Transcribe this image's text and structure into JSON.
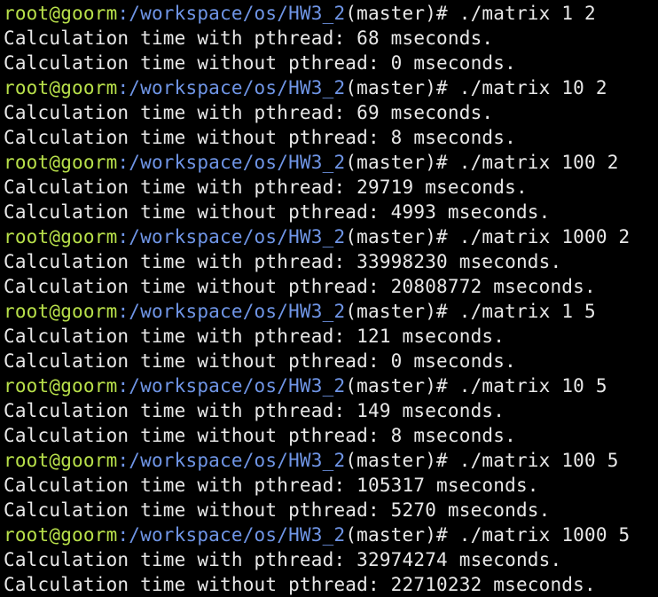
{
  "colors": {
    "background": "#000000",
    "prompt_user": "#b8e04a",
    "prompt_path": "#6f95e6",
    "text": "#e8e8e8"
  },
  "prompt": {
    "user_host": "root@goorm",
    "path": ":/workspace/os/HW3_2",
    "branch_suffix": "(master)# "
  },
  "runs": [
    {
      "command": "./matrix 1 2",
      "with_pthread": "Calculation time with pthread: 68 mseconds.",
      "without_pthread": "Calculation time without pthread: 0 mseconds."
    },
    {
      "command": "./matrix 10 2",
      "with_pthread": "Calculation time with pthread: 69 mseconds.",
      "without_pthread": "Calculation time without pthread: 8 mseconds."
    },
    {
      "command": "./matrix 100 2",
      "with_pthread": "Calculation time with pthread: 29719 mseconds.",
      "without_pthread": "Calculation time without pthread: 4993 mseconds."
    },
    {
      "command": "./matrix 1000 2",
      "with_pthread": "Calculation time with pthread: 33998230 mseconds.",
      "without_pthread": "Calculation time without pthread: 20808772 mseconds."
    },
    {
      "command": "./matrix 1 5",
      "with_pthread": "Calculation time with pthread: 121 mseconds.",
      "without_pthread": "Calculation time without pthread: 0 mseconds."
    },
    {
      "command": "./matrix 10 5",
      "with_pthread": "Calculation time with pthread: 149 mseconds.",
      "without_pthread": "Calculation time without pthread: 8 mseconds."
    },
    {
      "command": "./matrix 100 5",
      "with_pthread": "Calculation time with pthread: 105317 mseconds.",
      "without_pthread": "Calculation time without pthread: 5270 mseconds."
    },
    {
      "command": "./matrix 1000 5",
      "with_pthread": "Calculation time with pthread: 32974274 mseconds.",
      "without_pthread": "Calculation time without pthread: 22710232 mseconds."
    }
  ]
}
